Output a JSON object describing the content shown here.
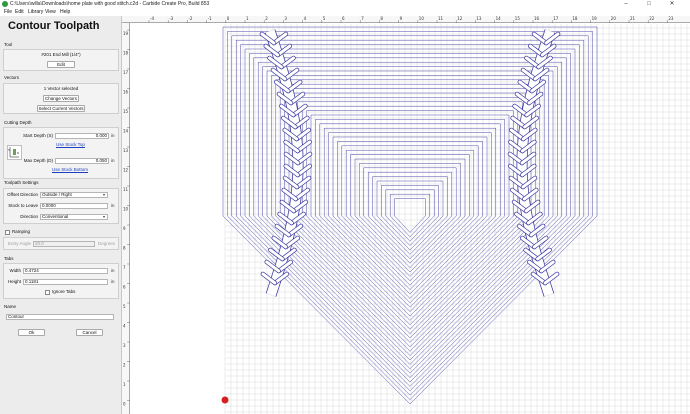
{
  "window": {
    "title": "C:\\Users\\willa\\Downloads\\home plate with good stitch.c2d - Carbide Create Pro, Build 853",
    "controls": [
      "–",
      "□",
      "✕"
    ]
  },
  "menu": [
    "File",
    "Edit",
    "Library",
    "View",
    "Help"
  ],
  "panel": {
    "title": "Contour Toolpath",
    "tool": {
      "section": "Tool",
      "name": "#201 End Mill (1/4\")",
      "edit_label": "Edit"
    },
    "vectors": {
      "section": "Vectors",
      "selected_text": "1 Vector selected",
      "change_label": "Change Vectors",
      "select_current_label": "Select Current Vectors"
    },
    "cutting_depth": {
      "section": "Cutting Depth",
      "start_label": "Start Depth (S)",
      "start_value": "0.000",
      "unit": "in",
      "use_stock_top": "Use Stock Top",
      "max_label": "Max Depth (D)",
      "max_value": "0.050",
      "use_stock_bottom": "Use Stock Bottom",
      "diagram_s": "S",
      "diagram_d": "D"
    },
    "settings": {
      "section": "Toolpath Settings",
      "offset_label": "Offset Direction",
      "offset_value": "Outside / Right",
      "stock_label": "Stock to Leave",
      "stock_value": "0.0000",
      "unit": "in",
      "direction_label": "Direction",
      "direction_value": "Conventional"
    },
    "ramping": {
      "label": "Ramping",
      "checked": false,
      "angle_label": "Entry Angle",
      "angle_value": "20.0",
      "angle_unit": "Degrees"
    },
    "tabs": {
      "section": "Tabs",
      "width_label": "Width",
      "width_value": "0.4724",
      "height_label": "Height",
      "height_value": "0.1181",
      "unit": "in",
      "ignore_label": "Ignore Tabs",
      "ignore_checked": false
    },
    "name": {
      "section": "Name",
      "value": "Contour"
    },
    "ok_label": "Ok",
    "cancel_label": "Cancel"
  },
  "rulers": {
    "top": [
      "-4",
      "-3",
      "-2",
      "-1",
      "0",
      "1",
      "2",
      "3",
      "4",
      "5",
      "6",
      "7",
      "8",
      "9",
      "10",
      "11",
      "12",
      "13",
      "14",
      "15",
      "16",
      "17",
      "18",
      "19",
      "20",
      "21",
      "22",
      "23"
    ],
    "left": [
      "19",
      "18",
      "17",
      "16",
      "15",
      "14",
      "13",
      "12",
      "11",
      "10",
      "9",
      "8",
      "7",
      "6",
      "5",
      "4",
      "3",
      "2",
      "1",
      "0"
    ]
  },
  "colors": {
    "toolpath": "#3a37a0",
    "grid": "#d2d2d2",
    "origin": "#d42020",
    "link": "#1c3fbf"
  }
}
